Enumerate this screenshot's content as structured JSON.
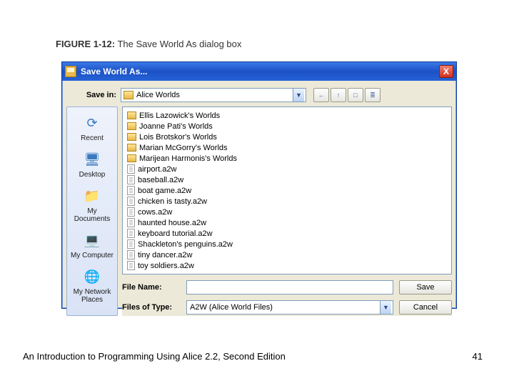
{
  "figure": {
    "label": "FIGURE 1-12:",
    "title": " The Save World As dialog box"
  },
  "dialog": {
    "title": "Save World As...",
    "close": "X",
    "save_in_label": "Save in:",
    "save_in_value": "Alice Worlds",
    "view_buttons": {
      "back": "←",
      "up": "↑",
      "new": "□",
      "list": "≣"
    },
    "places": [
      {
        "label": "Recent",
        "icon": "⟳"
      },
      {
        "label": "Desktop",
        "icon": "🖥"
      },
      {
        "label": "My Documents",
        "icon": "📁"
      },
      {
        "label": "My Computer",
        "icon": "💻"
      },
      {
        "label": "My Network Places",
        "icon": "🌐"
      }
    ],
    "folders": [
      "Ellis Lazowick's Worlds",
      "Joanne Pati's Worlds",
      "Lois Brotskor's Worlds",
      "Marian McGorry's Worlds",
      "Marijean Harmonis's Worlds"
    ],
    "files": [
      "airport.a2w",
      "baseball.a2w",
      "boat game.a2w",
      "chicken is tasty.a2w",
      "cows.a2w",
      "haunted house.a2w",
      "keyboard tutorial.a2w",
      "Shackleton's penguins.a2w",
      "tiny dancer.a2w",
      "toy soldiers.a2w"
    ],
    "filename_label": "File Name:",
    "filename_value": "",
    "filetype_label": "Files of Type:",
    "filetype_value": "A2W (Alice World Files)",
    "save_btn": "Save",
    "cancel_btn": "Cancel"
  },
  "footer": {
    "text": "An Introduction to Programming Using Alice 2.2, Second Edition",
    "page": "41"
  }
}
